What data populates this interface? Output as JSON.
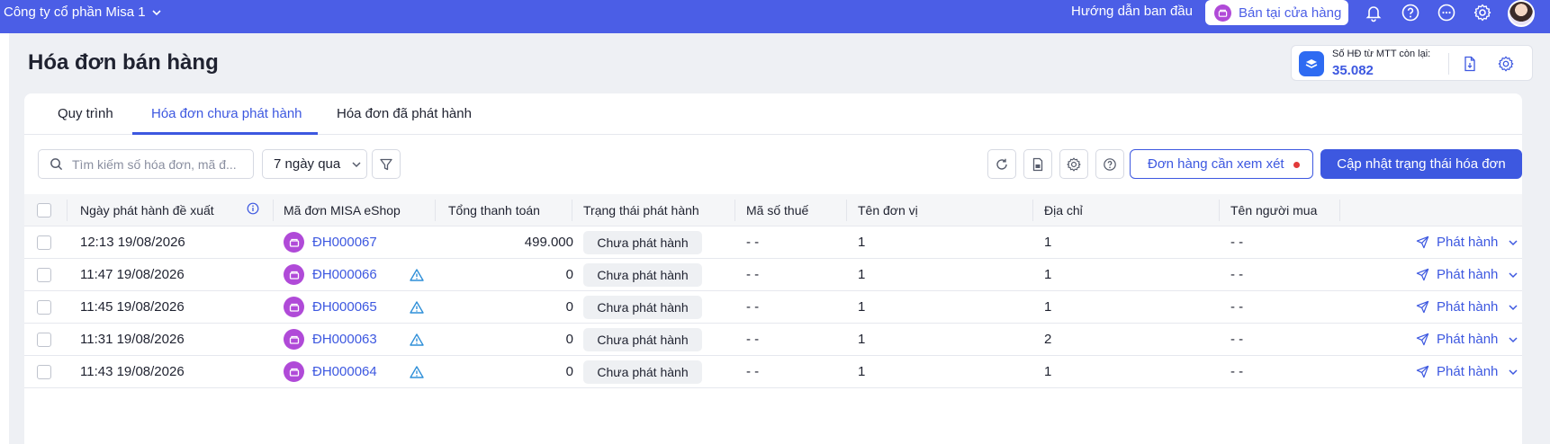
{
  "topbar": {
    "company": "Công ty cổ phần Misa 1",
    "guide": "Hướng dẫn ban đầu",
    "store_button": "Bán tại cửa hàng",
    "icons": [
      "bell-icon",
      "help-icon",
      "more-icon",
      "gear-icon",
      "avatar"
    ]
  },
  "page": {
    "title": "Hóa đơn bán hàng"
  },
  "mtt": {
    "label": "Số HĐ từ MTT còn lại:",
    "value": "35.082"
  },
  "tabs": [
    {
      "label": "Quy trình"
    },
    {
      "label": "Hóa đơn chưa phát hành"
    },
    {
      "label": "Hóa đơn đã phát hành"
    }
  ],
  "toolbar": {
    "search_placeholder": "Tìm kiếm số hóa đơn, mã đ...",
    "period": "7 ngày qua",
    "review_button": "Đơn hàng cần xem xét",
    "update_button": "Cập nhật trạng thái hóa đơn"
  },
  "columns": {
    "date": "Ngày phát hành đề xuất",
    "order": "Mã đơn MISA eShop",
    "total": "Tổng thanh toán",
    "status": "Trạng thái phát hành",
    "tax": "Mã số thuế",
    "unit": "Tên đơn vị",
    "address": "Địa chỉ",
    "buyer": "Tên người mua"
  },
  "rows": [
    {
      "date": "12:13 19/08/2026",
      "order": "ĐH000067",
      "total": "499.000",
      "status": "Chưa phát hành",
      "tax": "- -",
      "unit": "1",
      "address": "1",
      "buyer": "- -",
      "action": "Phát hành",
      "warning": false
    },
    {
      "date": "11:47 19/08/2026",
      "order": "ĐH000066",
      "total": "0",
      "status": "Chưa phát hành",
      "tax": "- -",
      "unit": "1",
      "address": "1",
      "buyer": "- -",
      "action": "Phát hành",
      "warning": true
    },
    {
      "date": "11:45 19/08/2026",
      "order": "ĐH000065",
      "total": "0",
      "status": "Chưa phát hành",
      "tax": "- -",
      "unit": "1",
      "address": "1",
      "buyer": "- -",
      "action": "Phát hành",
      "warning": true
    },
    {
      "date": "11:31 19/08/2026",
      "order": "ĐH000063",
      "total": "0",
      "status": "Chưa phát hành",
      "tax": "- -",
      "unit": "1",
      "address": "2",
      "buyer": "- -",
      "action": "Phát hành",
      "warning": true
    },
    {
      "date": "11:43 19/08/2026",
      "order": "ĐH000064",
      "total": "0",
      "status": "Chưa phát hành",
      "tax": "- -",
      "unit": "1",
      "address": "1",
      "buyer": "- -",
      "action": "Phát hành",
      "warning": true
    }
  ],
  "colors": {
    "topbar": "#4b5ee6",
    "accent": "#3d58e0",
    "shop": "#b04ad8",
    "warning": "#2f8fd8"
  }
}
